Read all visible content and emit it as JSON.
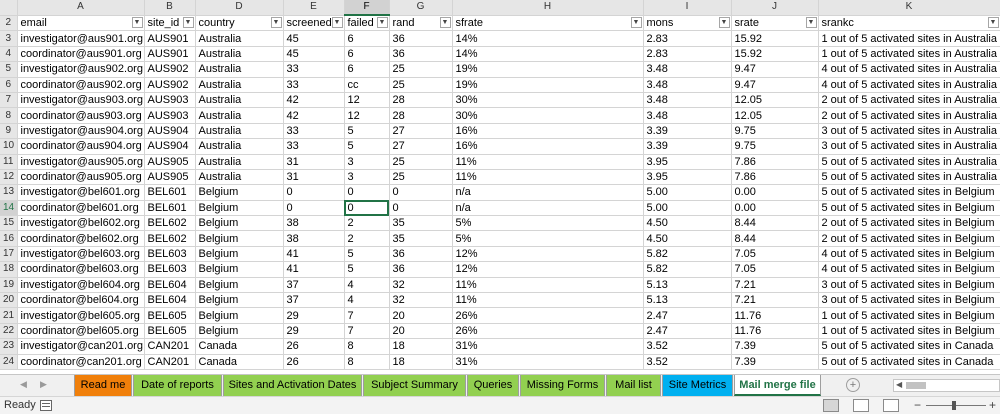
{
  "columns": [
    {
      "letter": "A",
      "field": "email"
    },
    {
      "letter": "B",
      "field": "site_id"
    },
    {
      "letter": "D",
      "field": "country"
    },
    {
      "letter": "E",
      "field": "screened"
    },
    {
      "letter": "F",
      "field": "failed"
    },
    {
      "letter": "G",
      "field": "rand"
    },
    {
      "letter": "H",
      "field": "sfrate"
    },
    {
      "letter": "I",
      "field": "mons"
    },
    {
      "letter": "J",
      "field": "srate"
    },
    {
      "letter": "K",
      "field": "srankc"
    }
  ],
  "header_row_number": "2",
  "rows": [
    {
      "n": "3",
      "cells": [
        "investigator@aus901.org",
        "AUS901",
        "Australia",
        "45",
        "6",
        "36",
        "14%",
        "2.83",
        "15.92",
        "1 out of 5 activated sites in Australia"
      ]
    },
    {
      "n": "4",
      "cells": [
        "coordinator@aus901.org",
        "AUS901",
        "Australia",
        "45",
        "6",
        "36",
        "14%",
        "2.83",
        "15.92",
        "1 out of 5 activated sites in Australia"
      ]
    },
    {
      "n": "5",
      "cells": [
        "investigator@aus902.org",
        "AUS902",
        "Australia",
        "33",
        "6",
        "25",
        "19%",
        "3.48",
        "9.47",
        "4 out of 5 activated sites in Australia"
      ]
    },
    {
      "n": "6",
      "cells": [
        "coordinator@aus902.org",
        "AUS902",
        "Australia",
        "33",
        "cc",
        "25",
        "19%",
        "3.48",
        "9.47",
        "4 out of 5 activated sites in Australia"
      ]
    },
    {
      "n": "7",
      "cells": [
        "investigator@aus903.org",
        "AUS903",
        "Australia",
        "42",
        "12",
        "28",
        "30%",
        "3.48",
        "12.05",
        "2 out of 5 activated sites in Australia"
      ]
    },
    {
      "n": "8",
      "cells": [
        "coordinator@aus903.org",
        "AUS903",
        "Australia",
        "42",
        "12",
        "28",
        "30%",
        "3.48",
        "12.05",
        "2 out of 5 activated sites in Australia"
      ]
    },
    {
      "n": "9",
      "cells": [
        "investigator@aus904.org",
        "AUS904",
        "Australia",
        "33",
        "5",
        "27",
        "16%",
        "3.39",
        "9.75",
        "3 out of 5 activated sites in Australia"
      ]
    },
    {
      "n": "10",
      "cells": [
        "coordinator@aus904.org",
        "AUS904",
        "Australia",
        "33",
        "5",
        "27",
        "16%",
        "3.39",
        "9.75",
        "3 out of 5 activated sites in Australia"
      ]
    },
    {
      "n": "11",
      "cells": [
        "investigator@aus905.org",
        "AUS905",
        "Australia",
        "31",
        "3",
        "25",
        "11%",
        "3.95",
        "7.86",
        "5 out of 5 activated sites in Australia"
      ]
    },
    {
      "n": "12",
      "cells": [
        "coordinator@aus905.org",
        "AUS905",
        "Australia",
        "31",
        "3",
        "25",
        "11%",
        "3.95",
        "7.86",
        "5 out of 5 activated sites in Australia"
      ]
    },
    {
      "n": "13",
      "cells": [
        "investigator@bel601.org",
        "BEL601",
        "Belgium",
        "0",
        "0",
        "0",
        "n/a",
        "5.00",
        "0.00",
        "5 out of 5 activated sites in Belgium"
      ]
    },
    {
      "n": "14",
      "cells": [
        "coordinator@bel601.org",
        "BEL601",
        "Belgium",
        "0",
        "0",
        "0",
        "n/a",
        "5.00",
        "0.00",
        "5 out of 5 activated sites in Belgium"
      ]
    },
    {
      "n": "15",
      "cells": [
        "investigator@bel602.org",
        "BEL602",
        "Belgium",
        "38",
        "2",
        "35",
        "5%",
        "4.50",
        "8.44",
        "2 out of 5 activated sites in Belgium"
      ]
    },
    {
      "n": "16",
      "cells": [
        "coordinator@bel602.org",
        "BEL602",
        "Belgium",
        "38",
        "2",
        "35",
        "5%",
        "4.50",
        "8.44",
        "2 out of 5 activated sites in Belgium"
      ]
    },
    {
      "n": "17",
      "cells": [
        "investigator@bel603.org",
        "BEL603",
        "Belgium",
        "41",
        "5",
        "36",
        "12%",
        "5.82",
        "7.05",
        "4 out of 5 activated sites in Belgium"
      ]
    },
    {
      "n": "18",
      "cells": [
        "coordinator@bel603.org",
        "BEL603",
        "Belgium",
        "41",
        "5",
        "36",
        "12%",
        "5.82",
        "7.05",
        "4 out of 5 activated sites in Belgium"
      ]
    },
    {
      "n": "19",
      "cells": [
        "investigator@bel604.org",
        "BEL604",
        "Belgium",
        "37",
        "4",
        "32",
        "11%",
        "5.13",
        "7.21",
        "3 out of 5 activated sites in Belgium"
      ]
    },
    {
      "n": "20",
      "cells": [
        "coordinator@bel604.org",
        "BEL604",
        "Belgium",
        "37",
        "4",
        "32",
        "11%",
        "5.13",
        "7.21",
        "3 out of 5 activated sites in Belgium"
      ]
    },
    {
      "n": "21",
      "cells": [
        "investigator@bel605.org",
        "BEL605",
        "Belgium",
        "29",
        "7",
        "20",
        "26%",
        "2.47",
        "11.76",
        "1 out of 5 activated sites in Belgium"
      ]
    },
    {
      "n": "22",
      "cells": [
        "coordinator@bel605.org",
        "BEL605",
        "Belgium",
        "29",
        "7",
        "20",
        "26%",
        "2.47",
        "11.76",
        "1 out of 5 activated sites in Belgium"
      ]
    },
    {
      "n": "23",
      "cells": [
        "investigator@can201.org",
        "CAN201",
        "Canada",
        "26",
        "8",
        "18",
        "31%",
        "3.52",
        "7.39",
        "5 out of 5 activated sites in Canada"
      ]
    },
    {
      "n": "24",
      "cells": [
        "coordinator@can201.org",
        "CAN201",
        "Canada",
        "26",
        "8",
        "18",
        "31%",
        "3.52",
        "7.39",
        "5 out of 5 activated sites in Canada"
      ]
    }
  ],
  "selection": {
    "column_letter": "F",
    "row_number": "14"
  },
  "sheet_tabs": [
    {
      "label": "Read me",
      "color": "#f07f0a"
    },
    {
      "label": "Date of reports",
      "color": "#92d050"
    },
    {
      "label": "Sites and Activation Dates",
      "color": "#92d050"
    },
    {
      "label": "Subject Summary",
      "color": "#92d050"
    },
    {
      "label": "Queries",
      "color": "#92d050"
    },
    {
      "label": "Missing Forms",
      "color": "#92d050"
    },
    {
      "label": "Mail list",
      "color": "#92d050"
    },
    {
      "label": "Site Metrics",
      "color": "#00b0f0"
    },
    {
      "label": "Mail merge file",
      "color": "#ffffff"
    }
  ],
  "active_tab": "Mail merge file",
  "status": {
    "ready": "Ready"
  },
  "colors": {
    "accent": "#217346",
    "header_bg": "#e6e6e6"
  }
}
